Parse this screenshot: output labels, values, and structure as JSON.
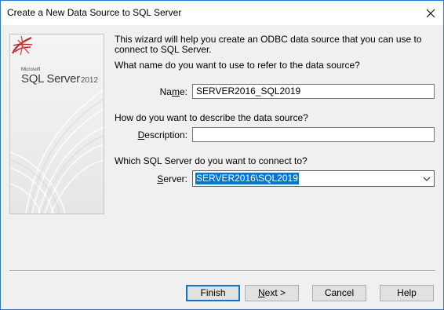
{
  "window": {
    "title": "Create a New Data Source to SQL Server",
    "close_label": "✕"
  },
  "side_panel": {
    "logo_small": "Microsoft",
    "logo_product": "SQL Server",
    "logo_version": "2012"
  },
  "intro_text": "This wizard will help you create an ODBC data source that you can use to connect to SQL Server.",
  "name_question": "What name do you want to use to refer to the data source?",
  "name_label": {
    "pre": "Na",
    "accel": "m",
    "post": "e:"
  },
  "name_value": "SERVER2016_SQL2019",
  "description_question": "How do you want to describe the data source?",
  "description_label": {
    "accel": "D",
    "post": "escription:"
  },
  "description_value": "",
  "server_question": "Which SQL Server do you want to connect to?",
  "server_label": {
    "accel": "S",
    "post": "erver:"
  },
  "server_value": "SERVER2016\\SQL2019",
  "buttons": {
    "finish": "Finish",
    "next_accel": "N",
    "next_rest": "ext >",
    "cancel": "Cancel",
    "help": "Help"
  },
  "colors": {
    "accent": "#0078d7",
    "window_border": "#2b79d4",
    "dialog_bg": "#f0f0f0"
  }
}
